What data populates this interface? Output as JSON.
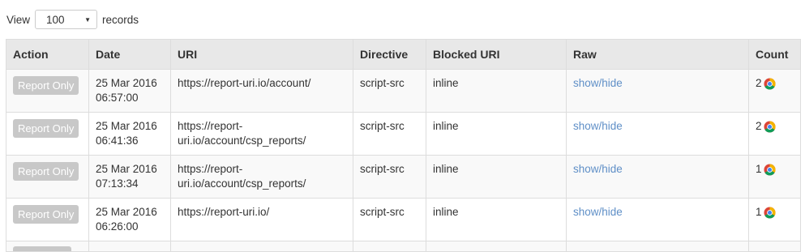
{
  "toolbar": {
    "view_label": "View",
    "page_size_value": "100",
    "records_label": "records"
  },
  "table": {
    "headers": {
      "action": "Action",
      "date": "Date",
      "uri": "URI",
      "directive": "Directive",
      "blocked_uri": "Blocked URI",
      "raw": "Raw",
      "count": "Count"
    },
    "rows": [
      {
        "action": "Report Only",
        "date_line1": "25 Mar 2016",
        "date_line2": "06:57:00",
        "uri": "https://report-uri.io/account/",
        "directive": "script-src",
        "blocked_uri": "inline",
        "raw": "show/hide",
        "count": "2",
        "browser_icon": "chrome-icon"
      },
      {
        "action": "Report Only",
        "date_line1": "25 Mar 2016",
        "date_line2": "06:41:36",
        "uri": "https://report-uri.io/account/csp_reports/",
        "directive": "script-src",
        "blocked_uri": "inline",
        "raw": "show/hide",
        "count": "2",
        "browser_icon": "chrome-icon"
      },
      {
        "action": "Report Only",
        "date_line1": "25 Mar 2016",
        "date_line2": "07:13:34",
        "uri": "https://report-uri.io/account/csp_reports/",
        "directive": "script-src",
        "blocked_uri": "inline",
        "raw": "show/hide",
        "count": "1",
        "browser_icon": "chrome-icon"
      },
      {
        "action": "Report Only",
        "date_line1": "25 Mar 2016",
        "date_line2": "06:26:00",
        "uri": "https://report-uri.io/",
        "directive": "script-src",
        "blocked_uri": "inline",
        "raw": "show/hide",
        "count": "1",
        "browser_icon": "chrome-icon"
      }
    ]
  },
  "colors": {
    "link": "#5f8fc7",
    "button_disabled": "#c8c8c8",
    "header_bg": "#e8e8e8",
    "stripe_bg": "#f9f9f9"
  }
}
